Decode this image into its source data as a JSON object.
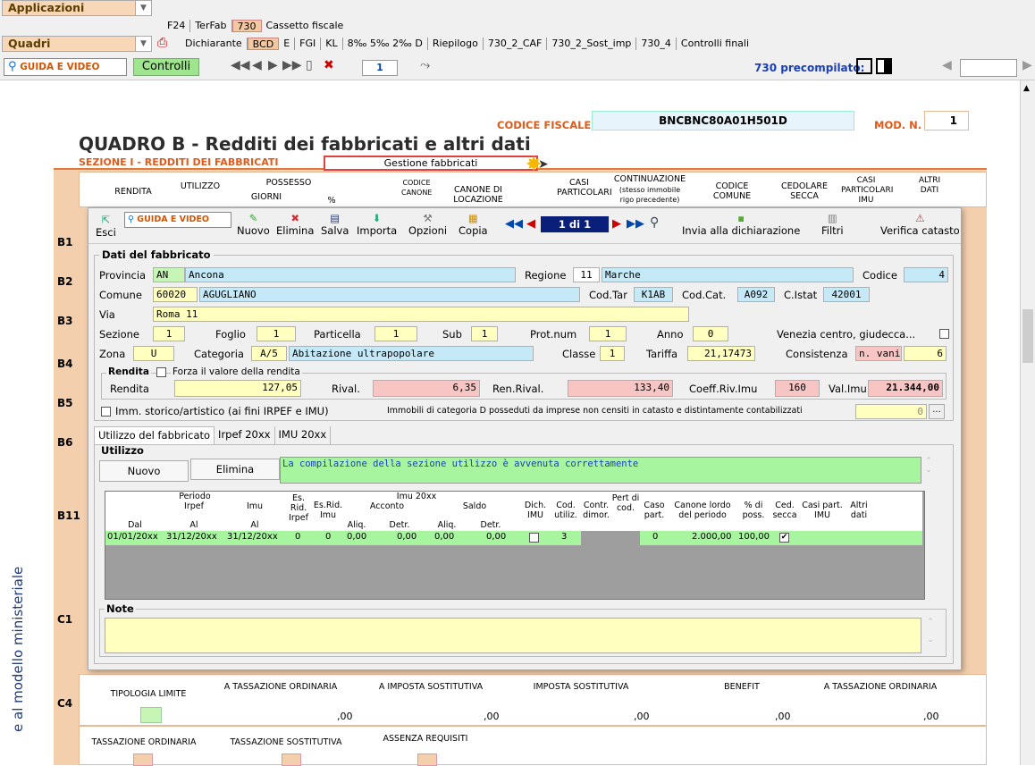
{
  "top": {
    "applicazioni_label": "Applicazioni",
    "quadri_label": "Quadri",
    "app_tabs": [
      "F24",
      "TerFab",
      "730",
      "Cassetto fiscale"
    ],
    "quadri_tabs": [
      "Dichiarante",
      "BCD",
      "E",
      "FGI",
      "KL",
      "8‰ 5‰ 2‰ D",
      "Riepilogo",
      "730_2_CAF",
      "730_2_Sost_imp",
      "730_4",
      "Controlli finali"
    ],
    "guida_label": "GUIDA E VIDEO",
    "controlli_label": "Controlli",
    "page_number": "1",
    "precompilato_label": "730 precompilato:"
  },
  "header": {
    "codice_fiscale_label": "CODICE FISCALE",
    "codice_fiscale_value": "BNCBNC80A01H501D",
    "mod_n_label": "MOD. N.",
    "mod_n_value": "1",
    "title": "QUADRO B - Redditi dei fabbricati e altri dati",
    "section": "SEZIONE I - REDDITI DEI FABBRICATI",
    "gestione_button": "Gestione fabbricati"
  },
  "columns": {
    "rendita": "RENDITA",
    "utilizzo": "UTILIZZO",
    "possesso": "POSSESSO",
    "giorni": "GIORNI",
    "percent": "%",
    "codice_canone": "CODICE CANONE",
    "canone_locazione": "CANONE DI LOCAZIONE",
    "casi_particolari": "CASI PARTICOLARI",
    "continuazione": "CONTINUAZIONE",
    "continuazione_sub": "(stesso immobile rigo precedente)",
    "codice_comune": "CODICE COMUNE",
    "cedolare_secca": "CEDOLARE SECCA",
    "casi_particolari_imu": "CASI PARTICOLARI IMU",
    "altri_dati": "ALTRI DATI"
  },
  "rows": [
    "B1",
    "B2",
    "B3",
    "B4",
    "B5",
    "B6",
    "B11"
  ],
  "modal": {
    "toolbar": [
      "Esci",
      "GUIDA E VIDEO",
      "Nuovo",
      "Elimina",
      "Salva",
      "Importa",
      "Opzioni",
      "Copia",
      "1 di 1",
      "Invia alla dichiarazione",
      "Filtri",
      "Verifica catasto"
    ],
    "dati_title": "Dati del fabbricato",
    "provincia_label": "Provincia",
    "provincia_code": "AN",
    "provincia_name": "Ancona",
    "regione_label": "Regione",
    "regione_code": "11",
    "regione_name": "Marche",
    "codice_label": "Codice",
    "codice_value": "4",
    "comune_label": "Comune",
    "comune_cap": "60020",
    "comune_name": "AGUGLIANO",
    "codtar_label": "Cod.Tar",
    "codtar_value": "K1AB",
    "codcat_label": "Cod.Cat.",
    "codcat_value": "A092",
    "cistat_label": "C.Istat",
    "cistat_value": "42001",
    "via_label": "Via",
    "via_value": "Roma 11",
    "sezione_label": "Sezione",
    "sezione_value": "1",
    "foglio_label": "Foglio",
    "foglio_value": "1",
    "particella_label": "Particella",
    "particella_value": "1",
    "sub_label": "Sub",
    "sub_value": "1",
    "protnum_label": "Prot.num",
    "protnum_value": "1",
    "anno_label": "Anno",
    "anno_value": "0",
    "venezia_label": "Venezia centro, giudecca...",
    "zona_label": "Zona",
    "zona_value": "U",
    "categoria_label": "Categoria",
    "categoria_code": "A/5",
    "categoria_desc": "Abitazione ultrapopolare",
    "classe_label": "Classe",
    "classe_value": "1",
    "tariffa_label": "Tariffa",
    "tariffa_value": "21,17473",
    "consistenza_label": "Consistenza",
    "consistenza_unit": "n. vani",
    "consistenza_value": "6",
    "rendita_group": "Rendita",
    "forza_label": "Forza il valore della rendita",
    "rendita_label": "Rendita",
    "rendita_value": "127,05",
    "rival_label": "Rival.",
    "rival_value": "6,35",
    "renrival_label": "Ren.Rival.",
    "renrival_value": "133,40",
    "coeff_label": "Coeff.Riv.Imu",
    "coeff_value": "160",
    "valimu_label": "Val.Imu",
    "valimu_value": "21.344,00",
    "storico_label": "Imm. storico/artistico (ai fini IRPEF e IMU)",
    "catd_label": "Immobili di categoria D posseduti da imprese non censiti in catasto e distintamente contabilizzati",
    "catd_value": "0",
    "tabs": [
      "Utilizzo del fabbricato",
      "Irpef 20xx",
      "IMU 20xx"
    ],
    "utilizzo_title": "Utilizzo",
    "nuovo": "Nuovo",
    "elimina": "Elimina",
    "status_msg": "La compilazione della sezione utilizzo è avvenuta correttamente",
    "note_title": "Note"
  },
  "grid": {
    "h_periodo": "Periodo",
    "h_irpef": "Irpef",
    "h_imu": "Imu",
    "h_esrid_irpef": "Es. Rid. Irpef",
    "h_imu20xx": "Imu 20xx",
    "h_esrid_imu": "Es.Rid. Imu",
    "h_acconto": "Acconto",
    "h_saldo": "Saldo",
    "h_dich_imu": "Dich. IMU",
    "h_cod_utiliz": "Cod. utiliz.",
    "h_contr_dimor": "Contr. dimor.",
    "h_pert_di_cod": "Pert di cod.",
    "h_caso_part": "Caso part.",
    "h_canone": "Canone lordo del periodo",
    "h_poss": "% di poss.",
    "h_ced": "Ced. secca",
    "h_casi_imu": "Casi part. IMU",
    "h_altri": "Altri dati",
    "h_dal": "Dal",
    "h_al1": "Al",
    "h_al2": "Al",
    "h_aliq1": "Aliq.",
    "h_detr1": "Detr.",
    "h_aliq2": "Aliq.",
    "h_detr2": "Detr.",
    "row": [
      "01/01/20xx",
      "31/12/20xx",
      "31/12/20xx",
      "0",
      "0",
      "0,00",
      "0,00",
      "0,00",
      "0,00",
      "",
      "3",
      "",
      "",
      "0",
      "2.000,00",
      "100,00",
      "",
      "",
      ""
    ]
  },
  "lower": {
    "tipologia_limite": "TIPOLOGIA LIMITE",
    "a_tassazione_ordinaria": "A TASSAZIONE ORDINARIA",
    "a_imposta_sostitutiva": "A IMPOSTA SOSTITUTIVA",
    "imposta_sostitutiva": "IMPOSTA SOSTITUTIVA",
    "benefit": "BENEFIT",
    "a_tassazione_ordinaria2": "A TASSAZIONE ORDINARIA",
    "zero": ",00",
    "tassazione_ordinaria": "TASSAZIONE ORDINARIA",
    "tassazione_sostitutiva": "TASSAZIONE SOSTITUTIVA",
    "assenza_requisiti": "ASSENZA REQUISITI",
    "c1": "C1",
    "c4": "C4",
    "sidebar_text": "e al modello ministeriale"
  }
}
